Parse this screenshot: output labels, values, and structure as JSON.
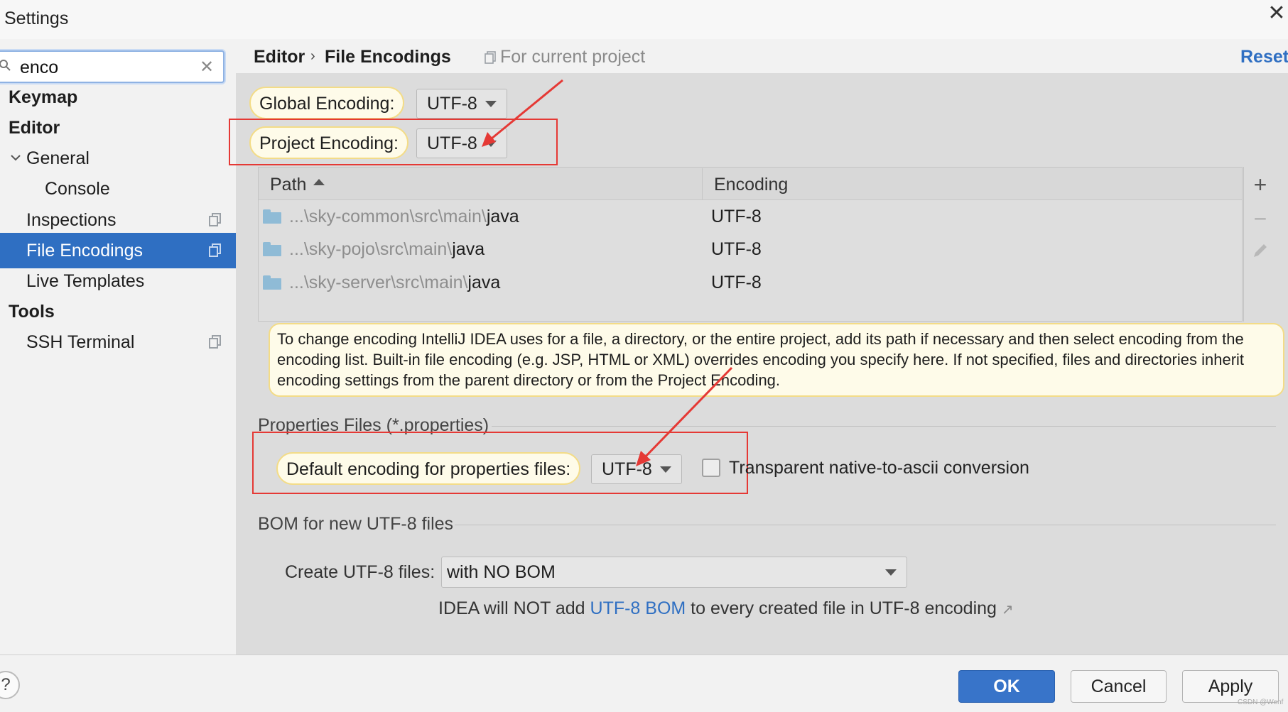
{
  "window": {
    "title": "Settings"
  },
  "search": {
    "value": "enco",
    "clear_icon": "close-icon"
  },
  "sidebar": {
    "items": [
      {
        "label": "Keymap"
      },
      {
        "label": "Editor"
      },
      {
        "label": "General"
      },
      {
        "label": "Console"
      },
      {
        "label": "Inspections"
      },
      {
        "label": "File Encodings"
      },
      {
        "label": "Live Templates"
      },
      {
        "label": "Tools"
      },
      {
        "label": "SSH Terminal"
      }
    ]
  },
  "header": {
    "breadcrumb": [
      "Editor",
      "File Encodings"
    ],
    "scope": "For current project",
    "reset": "Reset"
  },
  "encodings": {
    "global_label": "Global Encoding:",
    "global_value": "UTF-8",
    "project_label": "Project Encoding:",
    "project_value": "UTF-8"
  },
  "table": {
    "columns": [
      "Path",
      "Encoding"
    ],
    "rows": [
      {
        "path_prefix": "...\\sky-common\\src\\main\\",
        "path_leaf": "java",
        "encoding": "UTF-8"
      },
      {
        "path_prefix": "...\\sky-pojo\\src\\main\\",
        "path_leaf": "java",
        "encoding": "UTF-8"
      },
      {
        "path_prefix": "...\\sky-server\\src\\main\\",
        "path_leaf": "java",
        "encoding": "UTF-8"
      }
    ]
  },
  "tip": {
    "text": "To change encoding IntelliJ IDEA uses for a file, a directory, or the entire project, add its path if necessary and then select encoding from the encoding list. Built-in file encoding (e.g. JSP, HTML or XML) overrides encoding you specify here. If not specified, files and directories inherit encoding settings from the parent directory or from the Project Encoding."
  },
  "properties": {
    "section_title": "Properties Files (*.properties)",
    "default_label": "Default encoding for properties files:",
    "default_value": "UTF-8",
    "transparent_label": "Transparent native-to-ascii conversion",
    "transparent_checked": false
  },
  "bom": {
    "section_title": "BOM for new UTF-8 files",
    "create_label": "Create UTF-8 files:",
    "create_value": "with NO BOM",
    "note_before": "IDEA will NOT add ",
    "note_link": "UTF-8 BOM",
    "note_after": " to every created file in UTF-8 encoding",
    "note_ext": "↗"
  },
  "footer": {
    "help": "?",
    "ok": "OK",
    "cancel": "Cancel",
    "apply": "Apply"
  },
  "watermark": "CSDN @Wenf",
  "colors": {
    "accent": "#2f6fc2",
    "selection": "#2f6fc2",
    "tooltip_bg": "#fefbe9",
    "tooltip_border": "#f3dc87",
    "annotation_red": "#e53935"
  }
}
